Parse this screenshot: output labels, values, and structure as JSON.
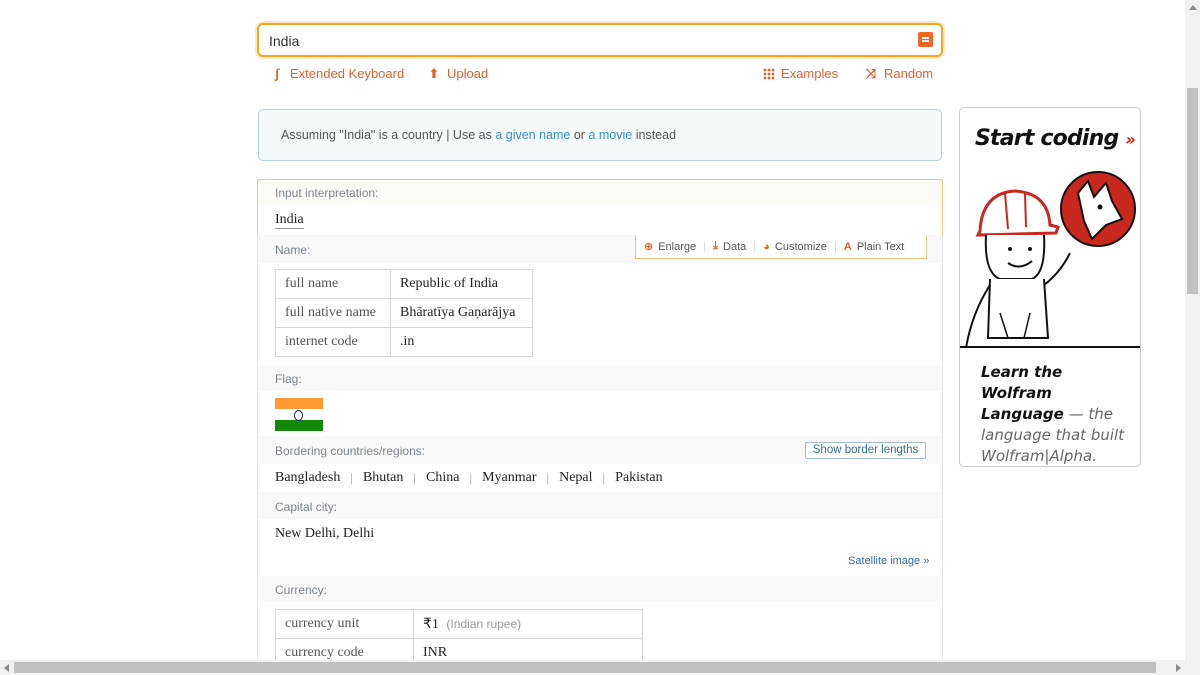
{
  "search": {
    "value": "India"
  },
  "toolbar": {
    "extended_keyboard": "Extended Keyboard",
    "upload": "Upload",
    "examples": "Examples",
    "random": "Random"
  },
  "assumption": {
    "prefix": "Assuming \"India\" is a country | Use as",
    "option1": "a given name",
    "or": "or",
    "option2": "a movie",
    "suffix": "instead"
  },
  "pods": {
    "input": {
      "title": "Input interpretation:",
      "value": "India"
    },
    "menu": {
      "enlarge": "Enlarge",
      "data": "Data",
      "customize": "Customize",
      "plain_text": "Plain Text"
    },
    "name": {
      "title": "Name:",
      "rows": [
        {
          "key": "full name",
          "value": "Republic of India"
        },
        {
          "key": "full native name",
          "value": "Bhāratīya Gaṇarājya"
        },
        {
          "key": "internet code",
          "value": ".in"
        }
      ]
    },
    "flag": {
      "title": "Flag:"
    },
    "borders": {
      "title": "Bordering countries/regions:",
      "button": "Show border lengths",
      "countries": [
        "Bangladesh",
        "Bhutan",
        "China",
        "Myanmar",
        "Nepal",
        "Pakistan"
      ],
      "separator": "|"
    },
    "capital": {
      "title": "Capital city:",
      "value": "New Delhi, Delhi",
      "link": "Satellite image »"
    },
    "currency": {
      "title": "Currency:",
      "rows": [
        {
          "key": "currency unit",
          "value": "₹1",
          "note": "(Indian rupee)"
        },
        {
          "key": "currency code",
          "value": "INR"
        }
      ]
    }
  },
  "ad": {
    "title": "Start coding",
    "arrows": "»",
    "text_bold": "Learn the Wolfram Language",
    "text_rest": " — the language that built Wolfram|Alpha."
  },
  "colors": {
    "accent": "#e2612c",
    "link": "#3a8fc6",
    "focus_border": "#f5a623"
  }
}
